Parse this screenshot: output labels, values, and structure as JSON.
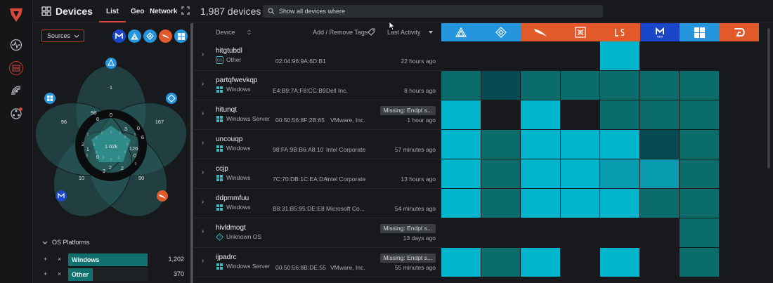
{
  "colors": {
    "accent": "#d9483b",
    "teal": "#11716f",
    "cyan": "#00b5cc",
    "dark": "#17191c"
  },
  "rail": {
    "icons": [
      "logo-icon",
      "activity-icon",
      "devices-icon",
      "radar-icon",
      "integrations-icon"
    ]
  },
  "header": {
    "title": "Devices",
    "tabs": [
      "List",
      "Geo",
      "Network"
    ],
    "count": "1,987 devices",
    "search_placeholder": "Show all devices where"
  },
  "panel": {
    "sources_label": "Sources",
    "venn_values": [
      "1",
      "96",
      "167",
      "98",
      "8",
      "1.02k",
      "3",
      "6",
      "2",
      "1",
      "126",
      "0",
      "0",
      "3",
      "2",
      "2",
      "10",
      "90",
      "0",
      "0"
    ],
    "os_header": "OS Platforms",
    "os_rows": [
      {
        "label": "Windows",
        "count": "1,202",
        "fraction": 1.0
      },
      {
        "label": "Other",
        "count": "370",
        "fraction": 0.31
      }
    ]
  },
  "table": {
    "columns": {
      "device": "Device",
      "tags": "Add / Remove Tags",
      "activity": "Last Activity"
    },
    "source_columns": [
      "source-a-icon",
      "source-b-icon",
      "source-c-icon",
      "source-d-icon",
      "source-e-icon",
      "source-f-icon",
      "source-g-icon",
      "source-h-icon"
    ],
    "rows": [
      {
        "name": "hitgtubdl",
        "os": "Other",
        "mac": "02:04:96:9A:6D:B1",
        "vendor": "",
        "time": "22 hours ago",
        "badge": ""
      },
      {
        "name": "partqfwevkqp",
        "os": "Windows",
        "mac": "E4:B9:7A:F8:CC:B9",
        "vendor": "Dell Inc.",
        "time": "8 hours ago",
        "badge": ""
      },
      {
        "name": "hitunqt",
        "os": "Windows Server",
        "mac": "00:50:56:8F:2B:65",
        "vendor": "VMware, Inc.",
        "time": "1 hour ago",
        "badge": "Missing: Endpt s..."
      },
      {
        "name": "uncouqp",
        "os": "Windows",
        "mac": "98:FA:9B:B6:A8:10",
        "vendor": "Intel Corporate",
        "time": "57 minutes ago",
        "badge": ""
      },
      {
        "name": "ccjp",
        "os": "Windows",
        "mac": "7C:70:DB:1C:EA:DA",
        "vendor": "Intel Corporate",
        "time": "13 hours ago",
        "badge": ""
      },
      {
        "name": "ddpmmfuu",
        "os": "Windows",
        "mac": "B8:31:B5:95:DE:E8",
        "vendor": "Microsoft Co...",
        "time": "54 minutes ago",
        "badge": ""
      },
      {
        "name": "hivldmogt",
        "os": "Unknown OS",
        "mac": "",
        "vendor": "",
        "time": "13 days ago",
        "badge": "Missing: Endpt s..."
      },
      {
        "name": "ijpadrc",
        "os": "Windows Server",
        "mac": "00:50:56:8B:DE:55",
        "vendor": "VMware, Inc.",
        "time": "55 minutes ago",
        "badge": "Missing: Endpt s..."
      }
    ],
    "grid": [
      [
        "e",
        "e",
        "e",
        "e",
        "c",
        "e",
        "e",
        "e"
      ],
      [
        "t",
        "d",
        "t",
        "t",
        "t",
        "t",
        "t",
        "e"
      ],
      [
        "c",
        "e",
        "c",
        "e",
        "t",
        "t",
        "t",
        "e"
      ],
      [
        "c",
        "t",
        "c",
        "c",
        "c",
        "d",
        "t",
        "e"
      ],
      [
        "c",
        "t",
        "c",
        "c",
        "m",
        "m",
        "t",
        "e"
      ],
      [
        "c",
        "t",
        "c",
        "c",
        "c",
        "t",
        "t",
        "e"
      ],
      [
        "e",
        "e",
        "e",
        "e",
        "e",
        "e",
        "t",
        "e"
      ],
      [
        "c",
        "t",
        "c",
        "e",
        "c",
        "e",
        "t",
        "e"
      ]
    ]
  }
}
